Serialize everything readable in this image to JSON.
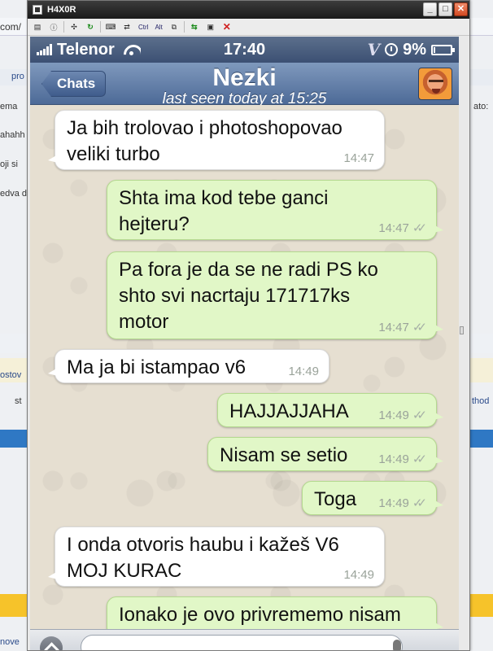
{
  "window": {
    "title": "H4X0R",
    "toolbar_ctrl": "Ctrl",
    "toolbar_alt": "Alt",
    "minimize": "_",
    "maximize": "□",
    "close": "✕"
  },
  "background_text": {
    "url_fragment": "com/",
    "fragment_pro": "pro",
    "fragment_ema": "ema",
    "fragment_ahahh": "ahahh",
    "fragment_ojisi": "oji si",
    "fragment_edva": "edva d",
    "fragment_ato": "ato:",
    "fragment_ostov": "ostov",
    "fragment_st": "st",
    "fragment_thod": "thod",
    "fragment_nove": "nove"
  },
  "status_bar": {
    "carrier": "Telenor",
    "time": "17:40",
    "battery": "9%",
    "battery_level": 0.09,
    "signal_bars": 5
  },
  "nav": {
    "back_label": "Chats",
    "contact_name": "Nezki",
    "last_seen": "last seen today at 15:25"
  },
  "messages": [
    {
      "direction": "in",
      "text": "Ja bih trolovao i photoshopovao\nveliki turbo",
      "time": "14:47",
      "read": false
    },
    {
      "direction": "out",
      "text": "Shta ima kod tebe ganci\nhejteru?",
      "time": "14:47",
      "read": true
    },
    {
      "direction": "out",
      "text": "Pa fora je da se ne radi PS ko\nshto svi nacrtaju 171717ks\nmotor",
      "time": "14:47",
      "read": true
    },
    {
      "direction": "in",
      "text": "Ma ja bi istampao v6",
      "time": "14:49",
      "read": false
    },
    {
      "direction": "out",
      "text": "HAJJAJJAHA",
      "time": "14:49",
      "read": true
    },
    {
      "direction": "out",
      "text": "Nisam se setio",
      "time": "14:49",
      "read": true
    },
    {
      "direction": "out",
      "text": "Toga",
      "time": "14:49",
      "read": true
    },
    {
      "direction": "in",
      "text": "I onda otvoris haubu i kažeš V6\nMOJ KURAC",
      "time": "14:49",
      "read": false
    },
    {
      "direction": "out",
      "text": "Ionako je ovo privrememo nisam",
      "time": "",
      "read": false
    }
  ],
  "colors": {
    "incoming_bubble": "#ffffff",
    "outgoing_bubble": "#e1f7c7",
    "navbar": "#5a76a3",
    "chat_background": "#e6dfd1"
  },
  "icons": {
    "wifi": "wifi-icon",
    "clock": "clock-icon",
    "battery": "battery-icon",
    "read_receipt": "double-check-icon",
    "camera": "camera-icon",
    "mic": "mic-icon"
  }
}
